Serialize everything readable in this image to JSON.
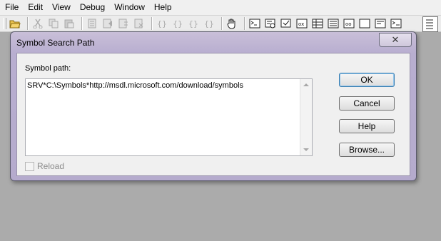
{
  "menubar": {
    "items": [
      "File",
      "Edit",
      "View",
      "Debug",
      "Window",
      "Help"
    ]
  },
  "dialog": {
    "title": "Symbol Search Path",
    "close_glyph": "✕",
    "symbol_path_label": "Symbol path:",
    "symbol_path_value": "SRV*C:\\Symbols*http://msdl.microsoft.com/download/symbols",
    "buttons": {
      "ok": "OK",
      "cancel": "Cancel",
      "help": "Help",
      "browse": "Browse..."
    },
    "reload_label": "Reload"
  }
}
